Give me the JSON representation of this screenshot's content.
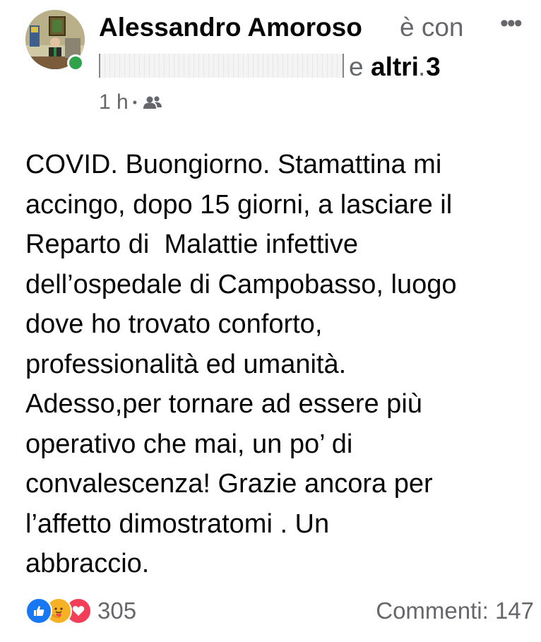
{
  "post": {
    "author": "Alessandro Amoroso",
    "with_text": "è con",
    "tagged_and": "e",
    "tagged_others": "altri 3",
    "tagged_end": ".",
    "time": "1 h",
    "separator": "•",
    "audience_icon": "friends-icon",
    "more_icon": "more-options-icon",
    "text_lines": [
      "COVID. Buongiorno. Stamattina mi",
      "accingo, dopo 15 giorni, a lasciare il",
      "Reparto di  Malattie infettive",
      "dell’ospedale di Campobasso, luogo",
      "dove ho trovato conforto,",
      "professionalità ed umanità.",
      "Adesso,per tornare ad essere più",
      "operativo che mai, un po’ di",
      "convalescenza! Grazie ancora per",
      "l’affetto dimostratomi . Un",
      "abbraccio."
    ]
  },
  "footer": {
    "reactions": [
      "like-icon",
      "care-icon",
      "love-icon"
    ],
    "reaction_count": "305",
    "comments": "Commenti: 147"
  },
  "colors": {
    "like": "#1877f2",
    "care": "#f7b125",
    "love": "#f33e58",
    "online": "#31a24c",
    "secondary_text": "#65676b"
  }
}
